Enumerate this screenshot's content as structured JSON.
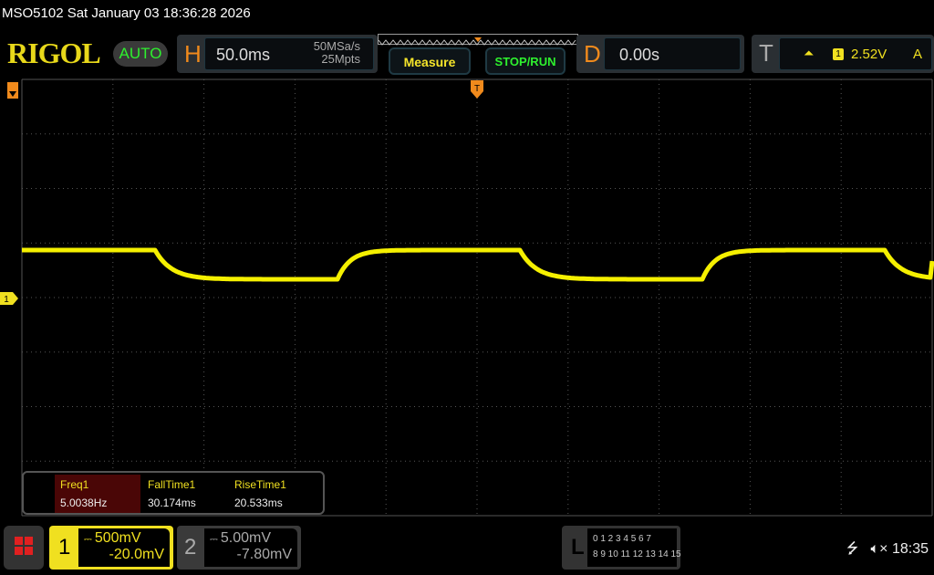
{
  "title_bar": "MSO5102  Sat January 03 18:36:28 2026",
  "logo": "RIGOL",
  "mode": "AUTO",
  "horizontal": {
    "letter": "H",
    "timebase": "50.0ms",
    "sample_rate": "50MSa/s",
    "memory_depth": "25Mpts"
  },
  "buttons": {
    "measure": "Measure",
    "stop_run": "STOP/RUN"
  },
  "delay": {
    "letter": "D",
    "value": "0.00s"
  },
  "trigger": {
    "letter": "T",
    "slope_icon": "rising-edge-icon",
    "source": "1",
    "level": "2.52V",
    "mode": "A"
  },
  "markers": {
    "trigger_pos": "T",
    "channel1": "1"
  },
  "measurements": [
    {
      "label": "Freq1",
      "value": "5.0038Hz"
    },
    {
      "label": "FallTime1",
      "value": "30.174ms"
    },
    {
      "label": "RiseTime1",
      "value": "20.533ms"
    }
  ],
  "channel1": {
    "number": "1",
    "coupling_icon": "dc-coupling-icon",
    "scale": "500mV",
    "offset": "-20.0mV",
    "color": "#f0e020"
  },
  "channel2": {
    "number": "2",
    "coupling_icon": "dc-coupling-icon",
    "scale": "5.00mV",
    "offset": "-7.80mV"
  },
  "logic": {
    "letter": "L",
    "row1": "0 1 2 3  4 5 6 7",
    "row2": "8 9 10 11 12 13 14 15"
  },
  "status": {
    "usb_icon": "usb-icon",
    "sound_icon": "mute-icon",
    "time": "18:35"
  },
  "colors": {
    "accent": "#f08a1c",
    "trace": "#f5f000",
    "grid": "#555555"
  }
}
